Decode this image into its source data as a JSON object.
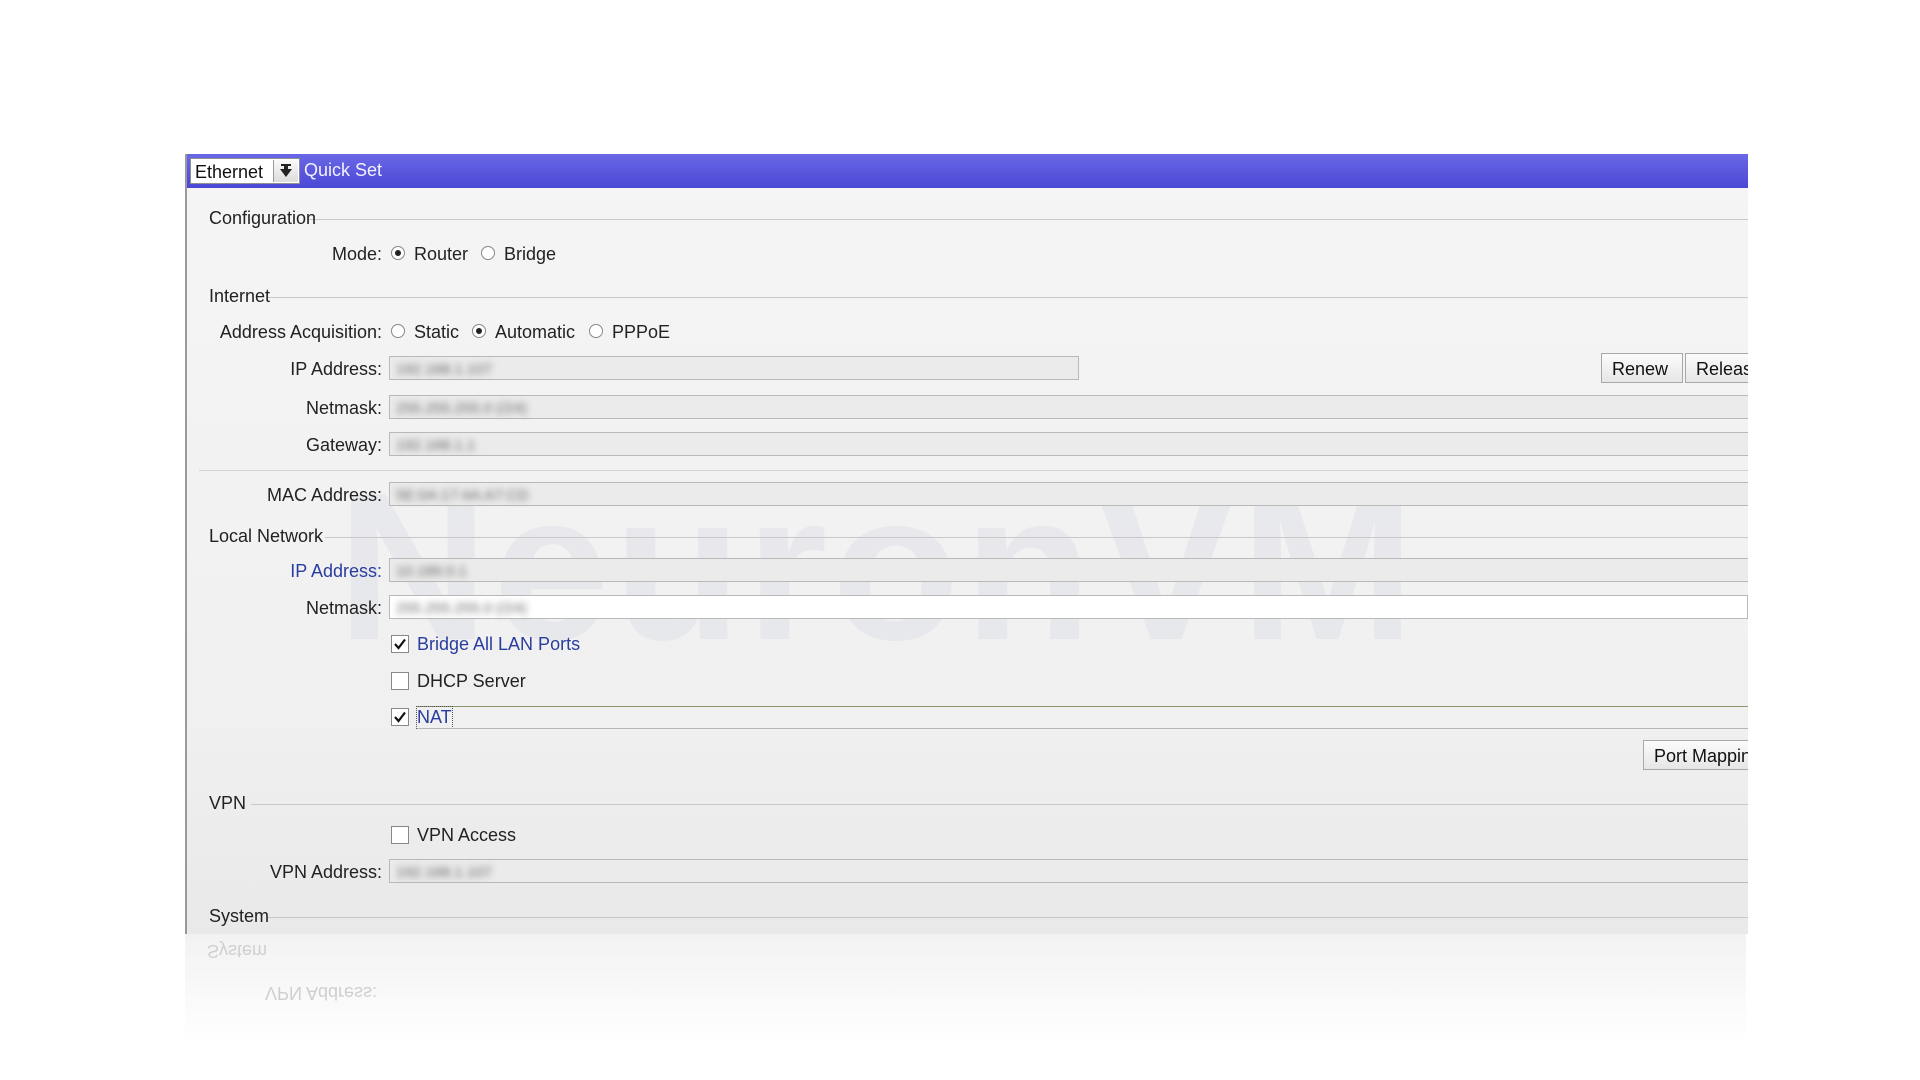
{
  "titlebar": {
    "mode_select_value": "Ethernet",
    "title": "Quick Set"
  },
  "watermark": "NeuronVM",
  "configuration": {
    "section_label": "Configuration",
    "mode_label": "Mode:",
    "options": [
      {
        "label": "Router",
        "selected": true
      },
      {
        "label": "Bridge",
        "selected": false
      }
    ]
  },
  "internet": {
    "section_label": "Internet",
    "address_acquisition_label": "Address Acquisition:",
    "address_options": [
      {
        "label": "Static",
        "selected": false
      },
      {
        "label": "Automatic",
        "selected": true
      },
      {
        "label": "PPPoE",
        "selected": false
      }
    ],
    "ip_address_label": "IP Address:",
    "ip_address_value": "192.168.1.107",
    "netmask_label": "Netmask:",
    "netmask_value": "255.255.255.0 (/24)",
    "gateway_label": "Gateway:",
    "gateway_value": "192.168.1.1",
    "renew_label": "Renew",
    "release_label": "Release",
    "mac_address_label": "MAC Address:",
    "mac_address_value": "5E:0A:17:4A:A7:CD"
  },
  "local_network": {
    "section_label": "Local Network",
    "ip_address_label": "IP Address:",
    "ip_address_value": "10.189.0.1",
    "netmask_label": "Netmask:",
    "netmask_value": "255.255.255.0 (/24)",
    "bridge_all_lan_ports_label": "Bridge All LAN Ports",
    "bridge_all_lan_ports_checked": true,
    "dhcp_server_label": "DHCP Server",
    "dhcp_server_checked": false,
    "nat_label": "NAT",
    "nat_checked": true,
    "port_mapping_label": "Port Mapping"
  },
  "vpn": {
    "section_label": "VPN",
    "vpn_access_label": "VPN Access",
    "vpn_access_checked": false,
    "vpn_address_label": "VPN Address:",
    "vpn_address_value": "192.168.1.107"
  },
  "system": {
    "section_label": "System"
  },
  "reflection": {
    "text_1": "System",
    "text_2": "VPN Address:"
  },
  "colors": {
    "titlebar": "#4b47d6",
    "accent_label": "#2a3d9e"
  }
}
